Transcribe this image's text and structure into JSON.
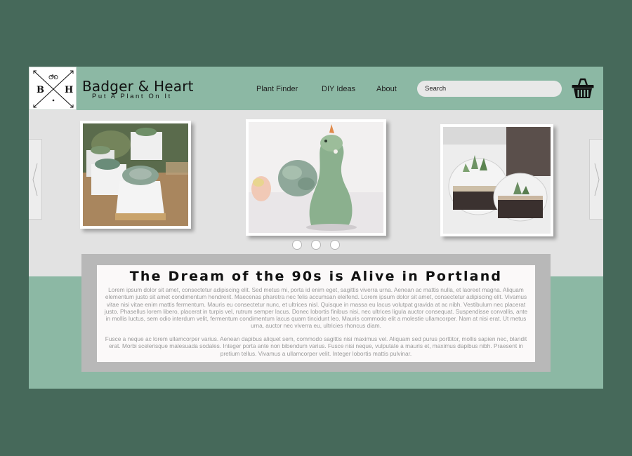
{
  "brand": {
    "logo_left": "B",
    "logo_right": "H",
    "title": "Badger & Heart",
    "tagline": "Put A Plant On It"
  },
  "nav": {
    "items": [
      {
        "label": "Plant Finder"
      },
      {
        "label": "DIY Ideas"
      },
      {
        "label": "About"
      }
    ]
  },
  "search": {
    "placeholder": "Search"
  },
  "icons": {
    "cart": "basket-icon",
    "logo": "bicycle-icon",
    "prev": "chevron-left-icon",
    "next": "chevron-right-icon"
  },
  "carousel": {
    "active_dot": 0,
    "dot_count": 3
  },
  "article": {
    "headline": "The Dream of the 90s is Alive in Portland",
    "paragraphs": [
      "Lorem ipsum dolor sit amet, consectetur adipiscing elit. Sed metus mi, porta id enim eget, sagittis viverra urna. Aenean ac mattis nulla, et laoreet magna. Aliquam elementum justo sit amet condimentum hendrerit. Maecenas pharetra nec felis accumsan eleifend. Lorem ipsum dolor sit amet, consectetur adipiscing elit. Vivamus vitae nisi vitae enim mattis fermentum. Mauris eu consectetur nunc, et ultrices nisl. Quisque in massa eu lacus volutpat gravida at ac nibh. Vestibulum nec placerat justo. Phasellus lorem libero, placerat in turpis vel, rutrum semper lacus. Donec lobortis finibus nisi, nec ultrices ligula auctor consequat. Suspendisse convallis, ante in mollis luctus, sem odio interdum velit, fermentum condimentum lacus quam tincidunt leo. Mauris commodo elit a molestie ullamcorper. Nam at nisi erat. Ut metus urna, auctor nec viverra eu, ultricies rhoncus diam.",
      "Fusce a neque ac lorem ullamcorper varius. Aenean dapibus aliquet sem, commodo sagittis nisi maximus vel. Aliquam sed purus porttitor, mollis sapien nec, blandit erat. Morbi scelerisque malesuada sodales. Integer porta ante non bibendum varius. Fusce nisi neque, vulputate a mauris et, maximus dapibus nibh. Praesent in pretium tellus. Vivamus a ullamcorper velit. Integer lobortis mattis pulvinar."
    ]
  },
  "colors": {
    "outer_background": "#46695a",
    "sage_accent": "#8cb8a4",
    "page_gray": "#e2e2e2",
    "panel_gray": "#b8b8b8"
  }
}
